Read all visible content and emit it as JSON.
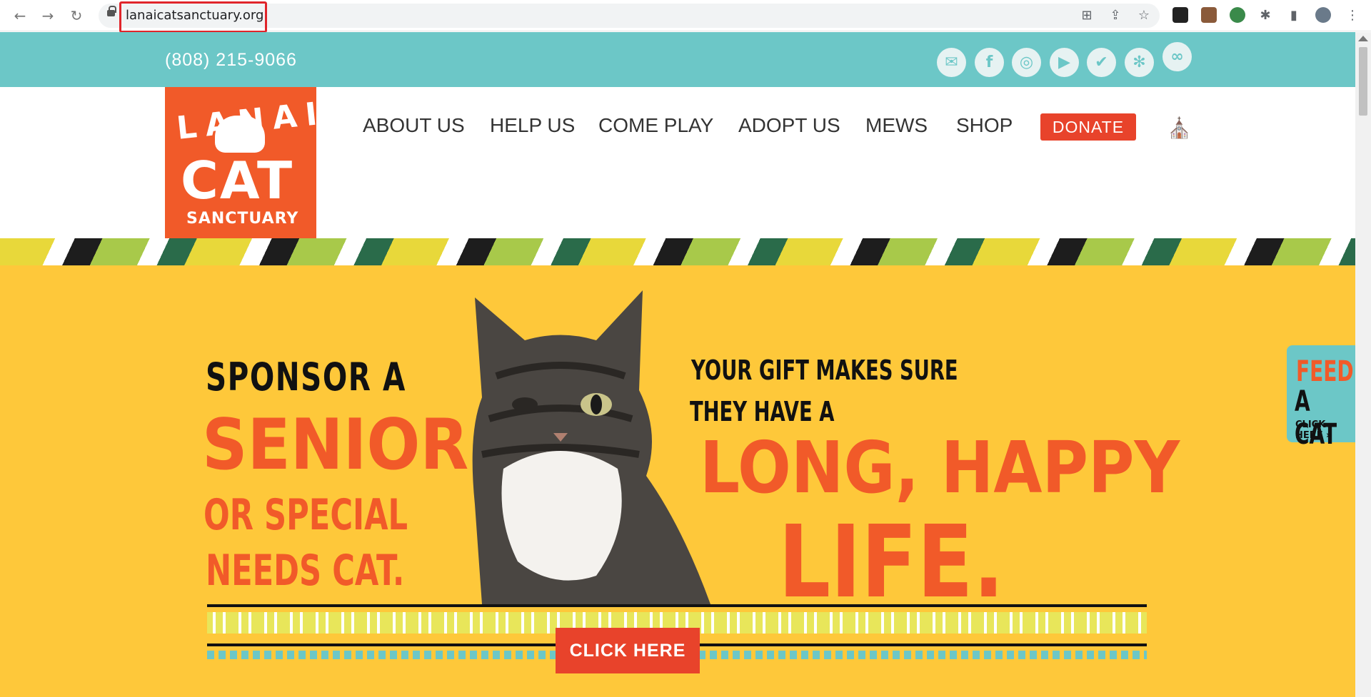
{
  "browser": {
    "url": "lanaicatsanctuary.org",
    "back_icon": "←",
    "forward_icon": "→",
    "reload_icon": "↻",
    "translate_icon": "⊞",
    "share_icon": "⇪",
    "star_icon": "☆",
    "extensions_icon": "✱",
    "sidepanel_icon": "▮",
    "menu_icon": "⋮"
  },
  "topbar": {
    "phone": "(808) 215-9066",
    "social": [
      {
        "name": "email",
        "glyph": "✉"
      },
      {
        "name": "facebook",
        "glyph": "f"
      },
      {
        "name": "instagram",
        "glyph": "◎"
      },
      {
        "name": "youtube",
        "glyph": "▶"
      },
      {
        "name": "twitter",
        "glyph": "✔"
      },
      {
        "name": "yelp",
        "glyph": "✻"
      },
      {
        "name": "tripadvisor",
        "glyph": "∞"
      }
    ]
  },
  "logo": {
    "line1": "LANAI",
    "line2": "CAT",
    "line3": "SANCTUARY"
  },
  "menu": {
    "items": [
      "ABOUT US",
      "HELP US",
      "COME PLAY",
      "ADOPT US",
      "MEWS",
      "SHOP"
    ],
    "donate": "DONATE",
    "cart_icon": "🛒"
  },
  "hero": {
    "sponsor": "SPONSOR A",
    "senior": "SENIOR",
    "or_special": "OR SPECIAL",
    "needs_cat": "NEEDS CAT.",
    "gift": "YOUR GIFT MAKES SURE",
    "they_have": "THEY HAVE A",
    "long_happy": "LONG, HAPPY",
    "life": "LIFE.",
    "button": "CLICK HERE"
  },
  "feed_tab": {
    "line1": "FEED",
    "line2": "A CAT",
    "line3": "CLICK HERE »"
  },
  "colors": {
    "teal": "#6cc7c7",
    "orange": "#f15a29",
    "yellow": "#fec83a",
    "donate_red": "#e8432b"
  }
}
